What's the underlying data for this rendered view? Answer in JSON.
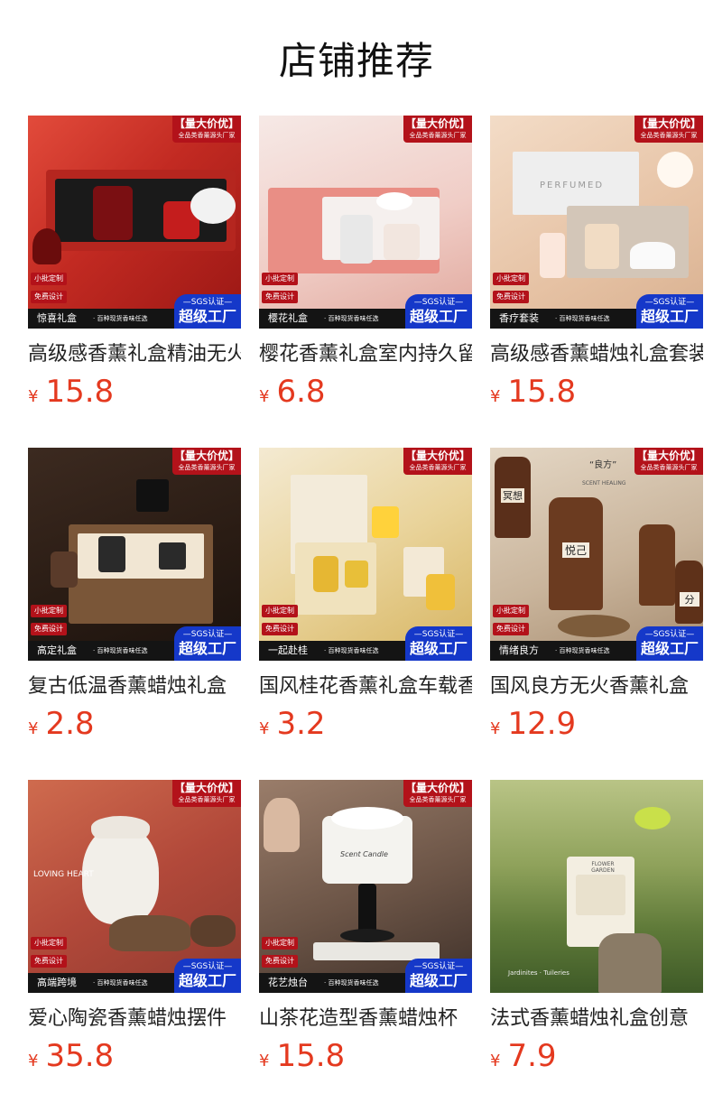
{
  "page": {
    "title": "店铺推荐"
  },
  "common": {
    "promo_main": "【量大价优】",
    "promo_sub": "全品类香薰源头厂家",
    "tag_small_batch": "小批定制",
    "tag_free_design": "免费设计",
    "strip_sub": "· 百种现货香味任选",
    "badge_top": "—SGS认证—",
    "badge_main": "超级工厂",
    "currency": "¥"
  },
  "products": [
    {
      "strip_name": "惊喜礼盒",
      "name": "高级感香薰礼盒精油无火香薰",
      "price": "15.8",
      "style": "red-box",
      "show_overlay": true
    },
    {
      "strip_name": "樱花礼盒",
      "name": "樱花香薰礼盒室内持久留香",
      "price": "6.8",
      "style": "pink-box",
      "show_overlay": true
    },
    {
      "strip_name": "香疗套装",
      "name": "高级感香薰蜡烛礼盒套装",
      "price": "15.8",
      "style": "marble-box",
      "show_overlay": true
    },
    {
      "strip_name": "高定礼盒",
      "name": "复古低温香薰蜡烛礼盒",
      "price": "2.8",
      "style": "dark-box",
      "show_overlay": true
    },
    {
      "strip_name": "一起赴桂",
      "name": "国风桂花香薰礼盒车载香",
      "price": "3.2",
      "style": "yellow-box",
      "show_overlay": true
    },
    {
      "strip_name": "情绪良方",
      "name": "国风良方无火香薰礼盒",
      "price": "12.9",
      "style": "bottles",
      "show_overlay": true
    },
    {
      "strip_name": "高端跨境",
      "name": "爱心陶瓷香薰蜡烛摆件",
      "price": "35.8",
      "style": "ceramic",
      "show_overlay": true
    },
    {
      "strip_name": "花艺烛台",
      "name": "山茶花造型香薰蜡烛杯",
      "price": "15.8",
      "style": "camellia",
      "show_overlay": true
    },
    {
      "strip_name": "",
      "name": "法式香薰蜡烛礼盒创意",
      "price": "7.9",
      "style": "garden",
      "show_overlay": false
    }
  ],
  "image_text": {
    "perfumed": "PERFUMED",
    "loving_heart": "LOVING HEART",
    "flower_garden": "FLOWER GARDEN",
    "scent_candle": "Scent Candle",
    "liangfang": "“良方”",
    "scent_healing": "SCENT HEALING",
    "bottle_1": "冥想",
    "bottle_2": "悦己",
    "bottle_3": "分",
    "jardinites": "Jardinites · Tuileries"
  },
  "colors": {
    "price": "#e4391f",
    "promo_red": "#b3121a",
    "badge_blue": "#1538c9"
  }
}
